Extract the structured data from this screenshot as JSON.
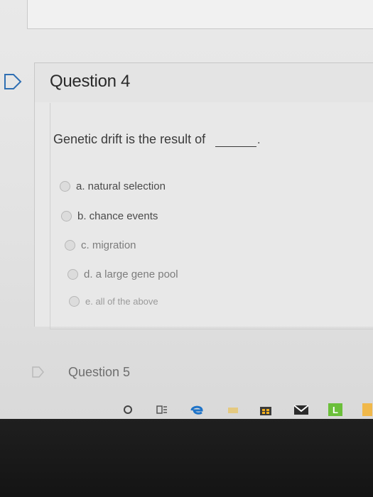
{
  "question": {
    "title": "Question 4",
    "text": "Genetic drift is the result of",
    "period": ".",
    "options": [
      {
        "label": "a. natural selection"
      },
      {
        "label": "b. chance events"
      },
      {
        "label": "c. migration"
      },
      {
        "label": "d. a large gene pool"
      },
      {
        "label": "e. all of the above"
      }
    ]
  },
  "next_question": {
    "title": "Question 5"
  },
  "taskbar": {
    "icons": [
      "search-icon",
      "task-view-icon",
      "edge-icon",
      "folder-icon",
      "store-icon",
      "mail-icon",
      "app-l-icon",
      "app-icon"
    ],
    "app_l_label": "L"
  }
}
